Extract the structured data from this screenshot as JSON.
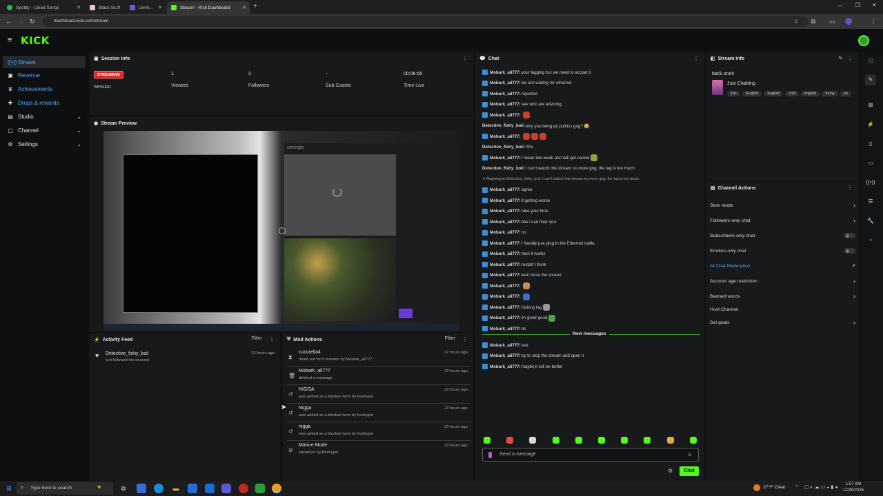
{
  "browser": {
    "tabs": [
      {
        "title": "Spotify – Liked Songs",
        "color": "#1db954"
      },
      {
        "title": "Black Sc...",
        "color": "#e8c6d6"
      },
      {
        "title": "Unmi...",
        "color": "#6e5ad6"
      },
      {
        "title": "Stream - Kick Dashboard",
        "color": "#53fc18"
      }
    ],
    "url": "dashboard.kick.com/stream"
  },
  "brand": {
    "logo": "KICK",
    "accent": "#53fc18",
    "link_color": "#53a8ff"
  },
  "sidebar": {
    "items": [
      {
        "label": "Stream",
        "icon": "broadcast-icon"
      },
      {
        "label": "Revenue",
        "icon": "wallet-icon"
      },
      {
        "label": "Achievements",
        "icon": "trophy-icon"
      },
      {
        "label": "Drops & rewards",
        "icon": "gift-icon"
      },
      {
        "label": "Studio",
        "icon": "studio-icon"
      },
      {
        "label": "Channel",
        "icon": "channel-icon"
      },
      {
        "label": "Settings",
        "icon": "gear-icon"
      }
    ]
  },
  "session": {
    "title": "Session Info",
    "status": "STREAMING",
    "status_label": "Session",
    "viewers_value": "1",
    "viewers_label": "Viewers",
    "followers_value": "2",
    "followers_label": "Followers",
    "subs_value": "-",
    "subs_label": "Sub Counts",
    "time_value": "00:06:55",
    "time_label": "Time Live"
  },
  "preview": {
    "title": "Stream Preview",
    "overlay_text": "umingle"
  },
  "activity": {
    "title": "Activity Feed",
    "filter": "Filter",
    "items": [
      {
        "name": "Detective_fishy_boii",
        "desc": "just followed the channel",
        "time": "23 hours ago"
      }
    ]
  },
  "mod": {
    "title": "Mod Actions",
    "filter": "Filter",
    "items": [
      {
        "name": "cucurella4",
        "desc": "timed out for 5 minutes by Mobark_ali777",
        "time": "22 hours ago",
        "icon": "hourglass-icon"
      },
      {
        "name": "Mobark_ali777",
        "desc": "deleted a message",
        "time": "23 hours ago",
        "icon": "trash-icon"
      },
      {
        "name": "NIGGA",
        "desc": "was added as a blocked term by freshypsi",
        "time": "23 hours ago",
        "icon": "undo-icon"
      },
      {
        "name": "Nigga",
        "desc": "was added as a blocked term by freshypsi",
        "time": "23 hours ago",
        "icon": "undo-icon"
      },
      {
        "name": "nigga",
        "desc": "was added as a blocked term by freshypsi",
        "time": "23 hours ago",
        "icon": "undo-icon"
      },
      {
        "name": "Mature Mode",
        "desc": "turned on by freshypsi",
        "time": "23 hours ago",
        "icon": "mature-icon"
      }
    ]
  },
  "chat": {
    "title": "Chat",
    "messages": [
      {
        "user": "Mobark_ali777:",
        "text": "your lagging but we need to accpet it",
        "badge": true
      },
      {
        "user": "Mobark_ali777:",
        "text": "we are waiting for ethernet",
        "badge": true
      },
      {
        "user": "Mobark_ali777:",
        "text": "reported",
        "badge": true
      },
      {
        "user": "Mobark_ali777:",
        "text": "see who are advicing",
        "badge": true
      },
      {
        "user": "Mobark_ali777:",
        "text": "",
        "badge": true,
        "emotes": [
          "#d23a2b"
        ]
      },
      {
        "user": "Detective_fishy_boii:",
        "text": "why you bring up politics gng? 😭",
        "badge": false
      },
      {
        "user": "Mobark_ali777:",
        "text": "",
        "badge": true,
        "emotes": [
          "#d23a2b",
          "#d23a2b",
          "#d23a2b"
        ]
      },
      {
        "user": "Detective_fishy_boii:",
        "text": "Stfu",
        "badge": false
      },
      {
        "user": "Mobark_ali777:",
        "text": "I mean two week and will get cancel",
        "badge": true,
        "emotes": [
          "#8aa53a"
        ]
      },
      {
        "user": "Detective_fishy_boii:",
        "text": "I can't watch this stream no more gng, the lag is too much",
        "badge": false
      },
      {
        "user": "",
        "text": "↳ Replying to Detective_fishy_boii: I can't watch this stream no more gng, the lag is too much",
        "badge": false,
        "reply": true
      },
      {
        "user": "Mobark_ali777:",
        "text": "agree",
        "badge": true
      },
      {
        "user": "Mobark_ali777:",
        "text": "it getting worse",
        "badge": true
      },
      {
        "user": "Mobark_ali777:",
        "text": "take your time",
        "badge": true
      },
      {
        "user": "Mobark_ali777:",
        "text": "btw i can hear you",
        "badge": true
      },
      {
        "user": "Mobark_ali777:",
        "text": "no",
        "badge": true
      },
      {
        "user": "Mobark_ali777:",
        "text": "I literally just plug in the Ethernet cable.",
        "badge": true
      },
      {
        "user": "Mobark_ali777:",
        "text": "then it works",
        "badge": true
      },
      {
        "user": "Mobark_ali777:",
        "text": "restart I think",
        "badge": true
      },
      {
        "user": "Mobark_ali777:",
        "text": "wait close the screen",
        "badge": true
      },
      {
        "user": "Mobark_ali777:",
        "text": "",
        "badge": true,
        "emotes": [
          "#c98a5a"
        ]
      },
      {
        "user": "Mobark_ali777:",
        "text": "",
        "badge": true,
        "emotes": [
          "#3a6ad6"
        ]
      },
      {
        "user": "Mobark_ali777:",
        "text": "fucking lag",
        "badge": true,
        "emotes": [
          "#9a9a9a"
        ]
      },
      {
        "user": "Mobark_ali777:",
        "text": "im good good",
        "badge": true,
        "emotes": [
          "#4aa34a"
        ]
      },
      {
        "user": "Mobark_ali777:",
        "text": "ok",
        "badge": true
      }
    ],
    "new_messages_label": "New messages",
    "new_messages": [
      {
        "user": "Mobark_ali777:",
        "text": "test",
        "badge": true
      },
      {
        "user": "Mobark_ali777:",
        "text": "try to stop the stream and open it",
        "badge": true
      },
      {
        "user": "Mobark_ali777:",
        "text": "maybe it will be better",
        "badge": true
      }
    ],
    "input_placeholder": "Send a message",
    "send_label": "Chat",
    "emote_bar": [
      "#53fc18",
      "#e34b4b",
      "#d8d8d8",
      "#53fc18",
      "#53fc18",
      "#53fc18",
      "#53fc18",
      "#53fc18",
      "#e8a83a",
      "#53fc18",
      "#53fc18"
    ]
  },
  "stream_info": {
    "title": "Stream Info",
    "stream_title": "back onnit",
    "category": "Just Chatting",
    "tags": [
      "18+",
      "English",
      "English",
      "chill",
      "english",
      "funny",
      "en"
    ]
  },
  "channel_actions": {
    "title": "Channel Actions",
    "items": [
      {
        "label": "Slow mode",
        "control": "chevron"
      },
      {
        "label": "Followers-only chat",
        "control": "chevron"
      },
      {
        "label": "Subscribers-only chat",
        "control": "toggle"
      },
      {
        "label": "Emotes-only chat",
        "control": "toggle"
      },
      {
        "label": "AI Chat Moderation",
        "control": "external",
        "highlight": true
      },
      {
        "label": "Account age restriction",
        "control": "chevron"
      },
      {
        "label": "Banned words",
        "control": "chevron"
      },
      {
        "label": "Host Channel",
        "control": "none"
      },
      {
        "label": "Set goals",
        "control": "chevron"
      }
    ]
  },
  "taskbar": {
    "search_placeholder": "Type here to search",
    "weather": "27°F  Clear",
    "time": "1:57 AM",
    "date": "12/30/2025"
  }
}
